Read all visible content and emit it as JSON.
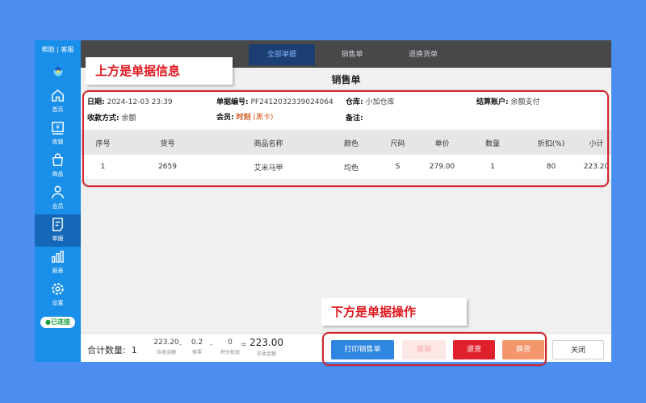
{
  "sidebar": {
    "help_text": "帮助 | 客服",
    "items": [
      {
        "label": "首页"
      },
      {
        "label": "收银"
      },
      {
        "label": "商品"
      },
      {
        "label": "会员"
      },
      {
        "label": "单据"
      },
      {
        "label": "报表"
      },
      {
        "label": "设置"
      }
    ],
    "connected_label": "已连接"
  },
  "tabs": [
    {
      "label": "全部单据"
    },
    {
      "label": "销售单"
    },
    {
      "label": "退换货单"
    }
  ],
  "document": {
    "title": "销售单",
    "date_label": "日期:",
    "date": "2024-12-03 23:39",
    "number_label": "单据编号:",
    "number": "PF2412032339024064",
    "warehouse_label": "仓库:",
    "warehouse": "小加仓库",
    "account_label": "结算账户:",
    "account": "余额支付",
    "payment_label": "收款方式:",
    "payment": "余额",
    "member_label": "会员:",
    "member_name": "时刻",
    "member_level": "(黑卡)",
    "remark_label": "备注:"
  },
  "table": {
    "headers": [
      "序号",
      "货号",
      "商品名称",
      "颜色",
      "尺码",
      "单价",
      "数量",
      "折扣(%)",
      "小计"
    ],
    "rows": [
      [
        "1",
        "2659",
        "艾米马甲",
        "均色",
        "S",
        "279.00",
        "1",
        "80",
        "223.20"
      ]
    ]
  },
  "footer": {
    "total_qty_label": "合计数量:",
    "total_qty": "1",
    "receivable": "223.20",
    "receivable_caption": "应收金额",
    "minus1": "-",
    "rounding": "0.2",
    "rounding_caption": "抹零",
    "minus2": "-",
    "points": "0",
    "points_caption": "积分抵现",
    "equals": "=",
    "actual": "223.00",
    "actual_caption": "实收金额"
  },
  "buttons": {
    "print": "打印销售单",
    "revoke": "撤销",
    "return": "退货",
    "exchange": "换货",
    "close": "关闭"
  },
  "annotations": {
    "top": "上方是单据信息",
    "bottom": "下方是单据操作"
  },
  "colors": {
    "sidebar": "#1a8fea",
    "print_button": "#2f86e0",
    "return_button": "#e0202c",
    "exchange_button": "#f3966c",
    "annotation_red": "#e0161d"
  }
}
